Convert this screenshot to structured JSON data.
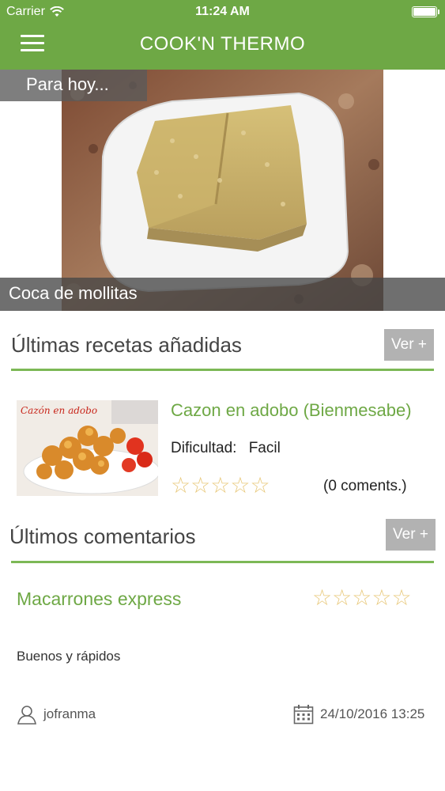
{
  "status": {
    "carrier": "Carrier",
    "time": "11:24 AM"
  },
  "header": {
    "title": "COOK'N THERMO",
    "menu_icon": "hamburger-menu-icon"
  },
  "hero": {
    "tag": "Para hoy...",
    "caption": "Coca de mollitas"
  },
  "latest_recipes": {
    "title": "Últimas recetas añadidas",
    "more_label": "Ver +",
    "items": [
      {
        "name": "Cazon en adobo (Bienmesabe)",
        "image_text": "Cazón en adobo",
        "difficulty_label": "Dificultad:",
        "difficulty_value": "Facil",
        "rating": 0,
        "comments": "(0 coments.)"
      }
    ]
  },
  "latest_comments": {
    "title": "Últimos comentarios",
    "more_label": "Ver +",
    "items": [
      {
        "recipe": "Macarrones express",
        "rating": 0,
        "text": "Buenos y rápidos",
        "user": "jofranma",
        "date": "24/10/2016 13:25"
      }
    ]
  },
  "colors": {
    "accent": "#6ea845",
    "button_gray": "#b2b2b2",
    "star": "#e8c87a"
  }
}
